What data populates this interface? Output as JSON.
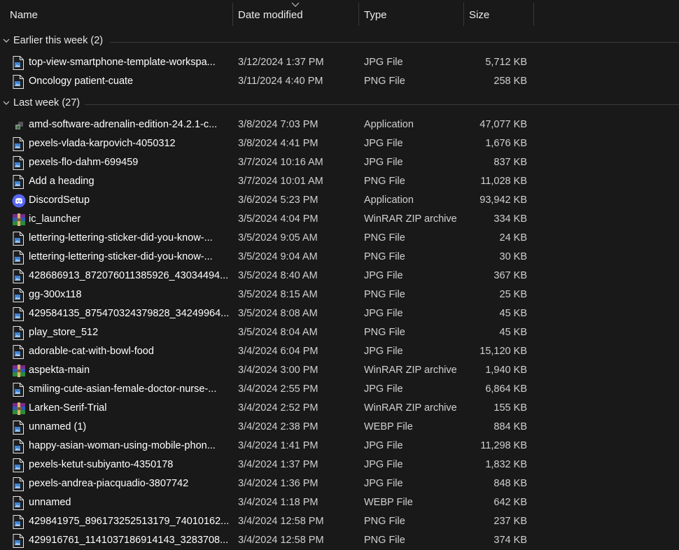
{
  "columns": {
    "name": "Name",
    "date": "Date modified",
    "type": "Type",
    "size": "Size"
  },
  "groups": [
    {
      "title": "Earlier this week (2)"
    },
    {
      "title": "Last week (27)"
    }
  ],
  "files": [
    {
      "name": "top-view-smartphone-template-workspa...",
      "date": "3/12/2024 1:37 PM",
      "type": "JPG File",
      "size": "5,712 KB",
      "icon": "image-file-icon"
    },
    {
      "name": "Oncology patient-cuate",
      "date": "3/11/2024 4:40 PM",
      "type": "PNG File",
      "size": "258 KB",
      "icon": "image-file-icon"
    },
    {
      "name": "amd-software-adrenalin-edition-24.2.1-c...",
      "date": "3/8/2024 7:03 PM",
      "type": "Application",
      "size": "47,077 KB",
      "icon": "amd-installer-icon"
    },
    {
      "name": "pexels-vlada-karpovich-4050312",
      "date": "3/8/2024 4:41 PM",
      "type": "JPG File",
      "size": "1,676 KB",
      "icon": "image-file-icon"
    },
    {
      "name": "pexels-flo-dahm-699459",
      "date": "3/7/2024 10:16 AM",
      "type": "JPG File",
      "size": "837 KB",
      "icon": "image-file-icon"
    },
    {
      "name": "Add a heading",
      "date": "3/7/2024 10:01 AM",
      "type": "PNG File",
      "size": "11,028 KB",
      "icon": "image-file-icon"
    },
    {
      "name": "DiscordSetup",
      "date": "3/6/2024 5:23 PM",
      "type": "Application",
      "size": "93,942 KB",
      "icon": "discord-icon"
    },
    {
      "name": "ic_launcher",
      "date": "3/5/2024 4:04 PM",
      "type": "WinRAR ZIP archive",
      "size": "334 KB",
      "icon": "winrar-archive-icon"
    },
    {
      "name": "lettering-lettering-sticker-did-you-know-...",
      "date": "3/5/2024 9:05 AM",
      "type": "PNG File",
      "size": "24 KB",
      "icon": "image-file-icon"
    },
    {
      "name": "lettering-lettering-sticker-did-you-know-...",
      "date": "3/5/2024 9:04 AM",
      "type": "PNG File",
      "size": "30 KB",
      "icon": "image-file-icon"
    },
    {
      "name": "428686913_872076011385926_43034494...",
      "date": "3/5/2024 8:40 AM",
      "type": "JPG File",
      "size": "367 KB",
      "icon": "image-file-icon"
    },
    {
      "name": "gg-300x118",
      "date": "3/5/2024 8:15 AM",
      "type": "PNG File",
      "size": "25 KB",
      "icon": "image-file-icon"
    },
    {
      "name": "429584135_875470324379828_34249964...",
      "date": "3/5/2024 8:08 AM",
      "type": "JPG File",
      "size": "45 KB",
      "icon": "image-file-icon"
    },
    {
      "name": "play_store_512",
      "date": "3/5/2024 8:04 AM",
      "type": "PNG File",
      "size": "45 KB",
      "icon": "image-file-icon"
    },
    {
      "name": "adorable-cat-with-bowl-food",
      "date": "3/4/2024 6:04 PM",
      "type": "JPG File",
      "size": "15,120 KB",
      "icon": "image-file-icon"
    },
    {
      "name": "aspekta-main",
      "date": "3/4/2024 3:00 PM",
      "type": "WinRAR ZIP archive",
      "size": "1,940 KB",
      "icon": "winrar-archive-icon"
    },
    {
      "name": "smiling-cute-asian-female-doctor-nurse-...",
      "date": "3/4/2024 2:55 PM",
      "type": "JPG File",
      "size": "6,864 KB",
      "icon": "image-file-icon"
    },
    {
      "name": "Larken-Serif-Trial",
      "date": "3/4/2024 2:52 PM",
      "type": "WinRAR ZIP archive",
      "size": "155 KB",
      "icon": "winrar-archive-icon"
    },
    {
      "name": "unnamed (1)",
      "date": "3/4/2024 2:38 PM",
      "type": "WEBP File",
      "size": "884 KB",
      "icon": "image-file-icon"
    },
    {
      "name": "happy-asian-woman-using-mobile-phon...",
      "date": "3/4/2024 1:41 PM",
      "type": "JPG File",
      "size": "11,298 KB",
      "icon": "image-file-icon"
    },
    {
      "name": "pexels-ketut-subiyanto-4350178",
      "date": "3/4/2024 1:37 PM",
      "type": "JPG File",
      "size": "1,832 KB",
      "icon": "image-file-icon"
    },
    {
      "name": "pexels-andrea-piacquadio-3807742",
      "date": "3/4/2024 1:36 PM",
      "type": "JPG File",
      "size": "848 KB",
      "icon": "image-file-icon"
    },
    {
      "name": "unnamed",
      "date": "3/4/2024 1:18 PM",
      "type": "WEBP File",
      "size": "642 KB",
      "icon": "image-file-icon"
    },
    {
      "name": "429841975_896173252513179_74010162...",
      "date": "3/4/2024 12:58 PM",
      "type": "PNG File",
      "size": "237 KB",
      "icon": "image-file-icon"
    },
    {
      "name": "429916761_1141037186914143_3283708...",
      "date": "3/4/2024 12:58 PM",
      "type": "PNG File",
      "size": "374 KB",
      "icon": "image-file-icon"
    }
  ],
  "colors": {
    "background": "#191919",
    "text": "#ffffff",
    "secondary_text": "#d0d0d0",
    "separator": "#3a3a3a",
    "image_icon_accent": "#3b82d6",
    "discord": "#5865f2"
  }
}
